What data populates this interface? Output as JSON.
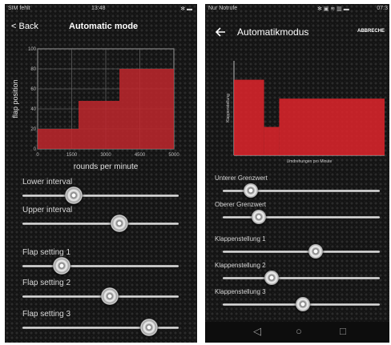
{
  "left": {
    "status": {
      "carrier": "SIM fehlt",
      "time": "13:48",
      "icons": "✻ ▬"
    },
    "back_label": "< Back",
    "title": "Automatic mode",
    "chart_data": {
      "type": "bar",
      "bins": [
        {
          "from": 0,
          "to": 1500,
          "value": 20
        },
        {
          "from": 1500,
          "to": 3000,
          "value": 48
        },
        {
          "from": 3000,
          "to": 5000,
          "value": 80
        }
      ],
      "xlim": [
        0,
        5000
      ],
      "ylim": [
        0,
        100
      ],
      "xticks": [
        "0",
        "1500",
        "3000",
        "4500",
        "5000"
      ],
      "yticks": [
        "0",
        "20",
        "40",
        "60",
        "80",
        "100"
      ],
      "ylabel": "flap position",
      "xlabel": "rounds per minute",
      "bar_color": "#c0272d",
      "grid": true
    },
    "sliders": [
      {
        "label": "Lower interval",
        "value": 0.33
      },
      {
        "label": "Upper interval",
        "value": 0.62
      },
      {
        "label": "Flap setting 1",
        "value": 0.25
      },
      {
        "label": "Flap setting 2",
        "value": 0.56
      },
      {
        "label": "Flap setting 3",
        "value": 0.81
      }
    ]
  },
  "right": {
    "status": {
      "carrier": "Nur Notrufe",
      "time": "07:3",
      "icons": "✻ ▣ ≋ ▥ ▬"
    },
    "back_icon": "arrow-left-icon",
    "title": "Automatikmodus",
    "action_label": "ABBRECHE",
    "chart_data": {
      "type": "bar",
      "bins": [
        {
          "from": 0,
          "to": 1000,
          "value": 80
        },
        {
          "from": 1000,
          "to": 1500,
          "value": 30
        },
        {
          "from": 1500,
          "to": 5000,
          "value": 60
        }
      ],
      "xlim": [
        0,
        5000
      ],
      "ylim": [
        0,
        100
      ],
      "ylabel": "Klappenstellung",
      "xlabel": "Umdrehungen pro Minute",
      "bar_color": "#e0242c",
      "grid": false
    },
    "sliders": [
      {
        "label": "Unterer Grenzwert",
        "value": 0.18
      },
      {
        "label": "Oberer Grenzwert",
        "value": 0.23
      },
      {
        "label": "Klappenstellung 1",
        "value": 0.59
      },
      {
        "label": "Klappenstellung 2",
        "value": 0.31
      },
      {
        "label": "Klappenstellung 3",
        "value": 0.51
      }
    ],
    "nav": {
      "back": "◁",
      "home": "○",
      "recents": "□"
    }
  }
}
